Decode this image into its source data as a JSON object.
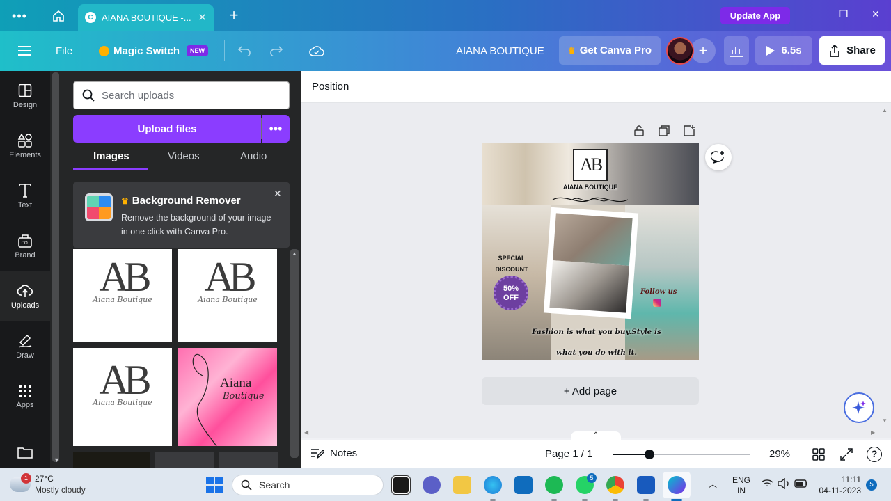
{
  "browser": {
    "tab_title": "AIANA BOUTIQUE -...",
    "update_app": "Update App"
  },
  "header": {
    "file": "File",
    "magic_switch": "Magic Switch",
    "new_badge": "NEW",
    "design_title": "AIANA BOUTIQUE",
    "get_pro": "Get Canva Pro",
    "present_time": "6.5s",
    "share": "Share"
  },
  "rail": {
    "items": [
      {
        "label": "Design",
        "icon": "design-icon"
      },
      {
        "label": "Elements",
        "icon": "elements-icon"
      },
      {
        "label": "Text",
        "icon": "text-icon"
      },
      {
        "label": "Brand",
        "icon": "brand-icon"
      },
      {
        "label": "Uploads",
        "icon": "uploads-icon"
      },
      {
        "label": "Draw",
        "icon": "draw-icon"
      },
      {
        "label": "Apps",
        "icon": "apps-icon"
      }
    ]
  },
  "panel": {
    "search_placeholder": "Search uploads",
    "upload_button": "Upload files",
    "tabs": [
      "Images",
      "Videos",
      "Audio"
    ],
    "bg_remover": {
      "title": "Background Remover",
      "text_line1": "Remove the background of your image",
      "text_line2": "in one click with Canva Pro."
    },
    "thumbs": [
      {
        "letters": "AB",
        "script": "Aiana Boutique"
      },
      {
        "letters": "AB",
        "script": "Aiana Boutique"
      },
      {
        "letters": "AB",
        "script": "Aiana Boutique"
      },
      {
        "title": "Aiana",
        "script": "Boutique"
      }
    ]
  },
  "editor": {
    "position": "Position",
    "add_page": "+ Add page",
    "notes": "Notes",
    "page_indicator": "Page 1 / 1",
    "zoom": "29%",
    "zoom_fraction": 0.27
  },
  "design": {
    "logo_letters": "AB",
    "brand": "AIANA BOUTIQUE",
    "special_line1": "SPECIAL",
    "special_line2": "DISCOUNT UPTO",
    "badge_line1": "50%",
    "badge_line2": "OFF",
    "follow": "Follow us",
    "tagline_line1": "Fashion is what you buy.Style is",
    "tagline_line2": "what you do with it."
  },
  "taskbar": {
    "weather_temp": "27°C",
    "weather_desc": "Mostly cloudy",
    "weather_badge": "1",
    "search": "Search",
    "whatsapp_badge": "5",
    "lang_line1": "ENG",
    "lang_line2": "IN",
    "time": "11:11",
    "date": "04-11-2023",
    "notif_count": "5"
  },
  "colors": {
    "canva_purple": "#8b3dff",
    "header_start": "#1fbfc9",
    "header_end": "#6a4fd9",
    "rail_bg": "#18191b",
    "panel_bg": "#252627"
  }
}
